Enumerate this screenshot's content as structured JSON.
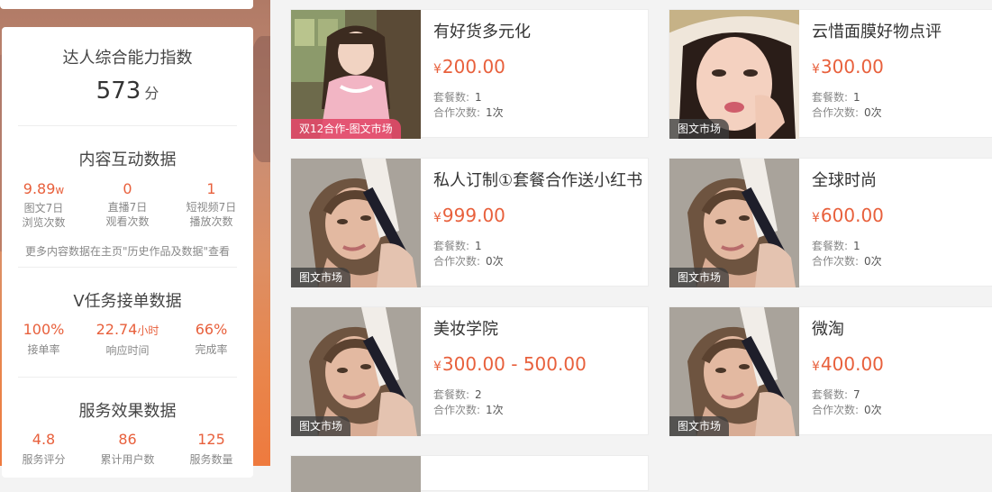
{
  "sidebar": {
    "ability_title": "达人综合能力指数",
    "ability_score": "573",
    "ability_unit": "分",
    "content_title": "内容互动数据",
    "content_stats": [
      {
        "value": "9.89",
        "unit": "w",
        "label1": "图文7日",
        "label2": "浏览次数"
      },
      {
        "value": "0",
        "unit": "",
        "label1": "直播7日",
        "label2": "观看次数"
      },
      {
        "value": "1",
        "unit": "",
        "label1": "短视频7日",
        "label2": "播放次数"
      }
    ],
    "content_note": "更多内容数据在主页\"历史作品及数据\"查看",
    "task_title": "V任务接单数据",
    "task_stats": [
      {
        "value": "100%",
        "unit": "",
        "label": "接单率"
      },
      {
        "value": "22.74",
        "unit": "小时",
        "label": "响应时间"
      },
      {
        "value": "66%",
        "unit": "",
        "label": "完成率"
      }
    ],
    "service_title": "服务效果数据",
    "service_stats": [
      {
        "value": "4.8",
        "label": "服务评分"
      },
      {
        "value": "86",
        "label": "累计用户数"
      },
      {
        "value": "125",
        "label": "服务数量"
      }
    ]
  },
  "labels": {
    "currency": "¥",
    "package_count": "套餐数:",
    "coop_count": "合作次数:"
  },
  "cards": [
    {
      "title": "有好货多元化",
      "price": "200.00",
      "packages": "1",
      "coops": "1次",
      "tag": "双12合作-图文市场",
      "image": "girl-pink-dress"
    },
    {
      "title": "云惜面膜好物点评",
      "price": "300.00",
      "packages": "1",
      "coops": "0次",
      "tag": "图文市场",
      "image": "woman-hat-portrait"
    },
    {
      "title": "私人订制①套餐合作送小红书",
      "price": "999.00",
      "packages": "1",
      "coops": "0次",
      "tag": "图文市场",
      "image": "woman-skincare-device"
    },
    {
      "title": "全球时尚",
      "price": "600.00",
      "packages": "1",
      "coops": "0次",
      "tag": "图文市场",
      "image": "woman-skincare-device"
    },
    {
      "title": "美妆学院",
      "price": "300.00 - 500.00",
      "packages": "2",
      "coops": "1次",
      "tag": "图文市场",
      "image": "woman-skincare-device"
    },
    {
      "title": "微淘",
      "price": "400.00",
      "packages": "7",
      "coops": "0次",
      "tag": "图文市场",
      "image": "woman-skincare-device"
    }
  ]
}
